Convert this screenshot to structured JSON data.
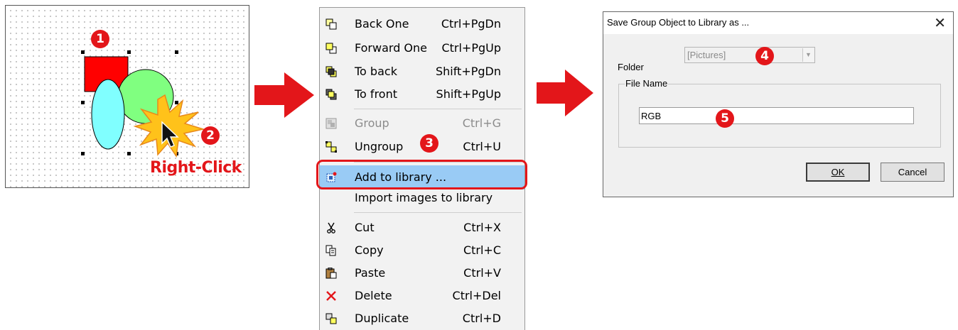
{
  "canvas": {
    "right_click_label": "Right-Click",
    "colors": {
      "rect": "#ff0000",
      "circle": "#80ff80",
      "ellipse": "#80ffff",
      "accent": "#e3161a"
    }
  },
  "badges": {
    "step1": "1",
    "step2": "2",
    "step3": "3",
    "step4": "4",
    "step5": "5"
  },
  "context_menu": {
    "items": [
      {
        "label": "Back One",
        "shortcut": "Ctrl+PgDn",
        "icon": "back-one-icon"
      },
      {
        "label": "Forward One",
        "shortcut": "Ctrl+PgUp",
        "icon": "forward-one-icon"
      },
      {
        "label": "To back",
        "shortcut": "Shift+PgDn",
        "icon": "to-back-icon"
      },
      {
        "label": "To front",
        "shortcut": "Shift+PgUp",
        "icon": "to-front-icon"
      },
      {
        "label": "Group",
        "shortcut": "Ctrl+G",
        "icon": "group-icon",
        "disabled": true
      },
      {
        "label": "Ungroup",
        "shortcut": "Ctrl+U",
        "icon": "ungroup-icon"
      },
      {
        "label": "Add to library ...",
        "shortcut": "",
        "icon": "add-to-library-icon",
        "highlighted": true
      },
      {
        "label": "Import images to library",
        "shortcut": ""
      },
      {
        "label": "Cut",
        "shortcut": "Ctrl+X",
        "icon": "cut-icon"
      },
      {
        "label": "Copy",
        "shortcut": "Ctrl+C",
        "icon": "copy-icon"
      },
      {
        "label": "Paste",
        "shortcut": "Ctrl+V",
        "icon": "paste-icon"
      },
      {
        "label": "Delete",
        "shortcut": "Ctrl+Del",
        "icon": "delete-icon"
      },
      {
        "label": "Duplicate",
        "shortcut": "Ctrl+D",
        "icon": "duplicate-icon"
      }
    ],
    "highlight_color": "#99cbf5"
  },
  "dialog": {
    "title": "Save Group Object to Library as ...",
    "close_glyph": "✕",
    "folder_label": "Folder",
    "folder_value": "[Pictures]",
    "file_name_group": "File Name",
    "file_name_value": "RGB",
    "ok_label": "OK",
    "cancel_label": "Cancel"
  }
}
